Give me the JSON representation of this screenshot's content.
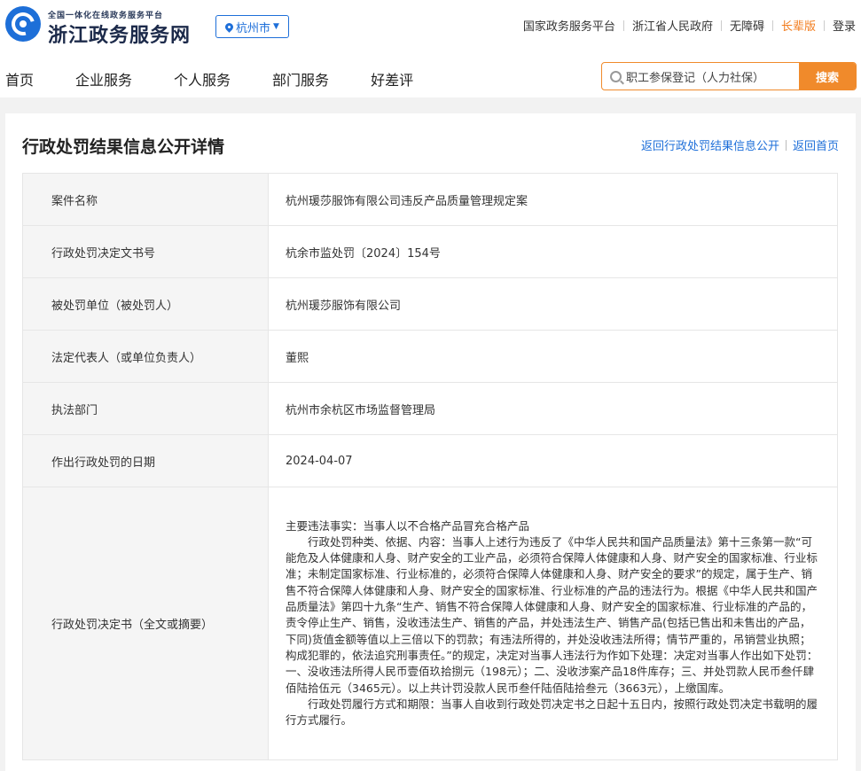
{
  "header": {
    "logo_subtitle": "全国一体化在线政务服务平台",
    "logo_title": "浙江政务服务网",
    "city": "杭州市",
    "top_links": [
      "国家政务服务平台",
      "浙江省人民政府",
      "无障碍",
      "长辈版",
      "登录"
    ],
    "nav": [
      "首页",
      "企业服务",
      "个人服务",
      "部门服务",
      "好差评"
    ],
    "search_placeholder": "职工参保登记（人力社保）",
    "search_button": "搜索"
  },
  "panel": {
    "title": "行政处罚结果信息公开详情",
    "back_list_link": "返回行政处罚结果信息公开",
    "back_home_link": "返回首页"
  },
  "rows": [
    {
      "label": "案件名称",
      "value": "杭州瑗莎服饰有限公司违反产品质量管理规定案"
    },
    {
      "label": "行政处罚决定文书号",
      "value": "杭余市监处罚〔2024〕154号"
    },
    {
      "label": "被处罚单位（被处罚人）",
      "value": "杭州瑗莎服饰有限公司"
    },
    {
      "label": "法定代表人（或单位负责人）",
      "value": "董熙"
    },
    {
      "label": "执法部门",
      "value": "杭州市余杭区市场监督管理局"
    },
    {
      "label": "作出行政处罚的日期",
      "value": "2024-04-07"
    }
  ],
  "decision": {
    "label": "行政处罚决定书（全文或摘要）",
    "para1": "主要违法事实：当事人以不合格产品冒充合格产品",
    "para2": "行政处罚种类、依据、内容：当事人上述行为违反了《中华人民共和国产品质量法》第十三条第一款“可能危及人体健康和人身、财产安全的工业产品，必须符合保障人体健康和人身、财产安全的国家标准、行业标准；未制定国家标准、行业标准的，必须符合保障人体健康和人身、财产安全的要求”的规定，属于生产、销售不符合保障人体健康和人身、财产安全的国家标准、行业标准的产品的违法行为。根据《中华人民共和国产品质量法》第四十九条“生产、销售不符合保障人体健康和人身、财产安全的国家标准、行业标准的产品的，责令停止生产、销售，没收违法生产、销售的产品，并处违法生产、销售产品(包括已售出和未售出的产品，下同)货值金额等值以上三倍以下的罚款；有违法所得的，并处没收违法所得；情节严重的，吊销营业执照；构成犯罪的，依法追究刑事责任。”的规定，决定对当事人违法行为作如下处理：决定对当事人作出如下处罚：一、没收违法所得人民币壹佰玖拾捌元（198元）；二、没收涉案产品18件库存；三、并处罚款人民币叁仟肆佰陆拾伍元（3465元）。以上共计罚没款人民币叁仟陆佰陆拾叁元（3663元），上缴国库。",
    "para3": "行政处罚履行方式和期限：当事人自收到行政处罚决定书之日起十五日内，按照行政处罚决定书载明的履行方式履行。"
  }
}
